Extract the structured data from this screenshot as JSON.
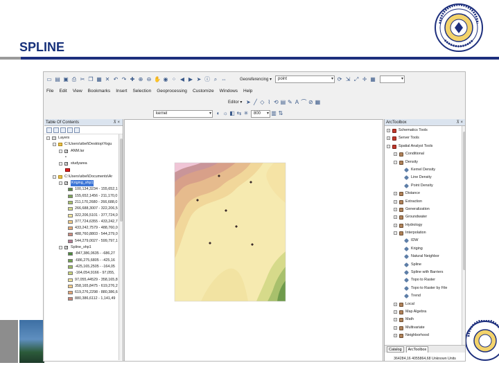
{
  "slide": {
    "title": "SPLINE"
  },
  "toolbar": {
    "georeferencing_label": "Georeferencing ▾",
    "layer_combo": "point",
    "editor_label": "Editor ▾",
    "density_combo": "kernel",
    "cell_size": "800"
  },
  "menu": [
    "File",
    "Edit",
    "View",
    "Bookmarks",
    "Insert",
    "Selection",
    "Geoprocessing",
    "Customize",
    "Windows",
    "Help"
  ],
  "toc": {
    "title": "Table Of Contents",
    "pin": "⊼ ×",
    "items": [
      {
        "text": "Layers",
        "indent": 0,
        "kind": "group"
      },
      {
        "text": "C:\\Users\\sibel\\Desktop\\Yogu",
        "indent": 1,
        "kind": "folder"
      },
      {
        "text": "ANM.lar",
        "indent": 2,
        "kind": "check"
      },
      {
        "text": "•",
        "indent": 3,
        "kind": "plain"
      },
      {
        "text": "studyarea",
        "indent": 2,
        "kind": "check"
      },
      {
        "text": "",
        "indent": 3,
        "kind": "redbox"
      },
      {
        "text": "C:\\Users\\sibel\\Documents\\Ar",
        "indent": 1,
        "kind": "folder"
      },
      {
        "text": "Kriging_shp1",
        "indent": 2,
        "kind": "selected"
      }
    ],
    "kriging_classes": [
      {
        "label": "100,134,3234 - 155,652,1",
        "color": "#5a8a44"
      },
      {
        "label": "155,652,1456 - 211,170,0",
        "color": "#7da457"
      },
      {
        "label": "211,170,2680 - 266,688,0",
        "color": "#a8c06c"
      },
      {
        "label": "266,688,3007 - 322,206,5",
        "color": "#d4d88a"
      },
      {
        "label": "322,206,5101 - 377,724,0",
        "color": "#f2e69d"
      },
      {
        "label": "377,724,6355 - 433,242,7",
        "color": "#f1cc87"
      },
      {
        "label": "433,242,7579 - 488,760,0",
        "color": "#e3a876"
      },
      {
        "label": "488,760,8803 - 544,279,0",
        "color": "#c98a7d"
      },
      {
        "label": "544,279,0027 - 599,797,1",
        "color": "#b37a92"
      }
    ],
    "spline_layer": "Spline_shp1",
    "spline_classes": [
      {
        "label": "-847,386,0635 - -686,27",
        "color": "#4d8a3e"
      },
      {
        "label": "-686,275,6805 - -425,16",
        "color": "#71a050"
      },
      {
        "label": "-425,165,2505 - -164,05",
        "color": "#9cbb63"
      },
      {
        "label": "-164,054,9166 - 97,055,",
        "color": "#c8d27b"
      },
      {
        "label": "97,055,44529 - 358,165,8",
        "color": "#eee199"
      },
      {
        "label": "358,165,8475 - 619,276,2",
        "color": "#f3cb88"
      },
      {
        "label": "619,276,2298 - 880,386,6",
        "color": "#e3a676"
      },
      {
        "label": "880,386,6112 - 1,141,49",
        "color": "#c98778"
      }
    ]
  },
  "toolbox": {
    "title": "ArcToolbox",
    "pin": "⊼ ×",
    "items": [
      {
        "text": "Schematics Tools",
        "indent": 0,
        "icon": "tools"
      },
      {
        "text": "Server Tools",
        "indent": 0,
        "icon": "tools"
      },
      {
        "text": "Spatial Analyst Tools",
        "indent": 0,
        "icon": "tools"
      },
      {
        "text": "Conditional",
        "indent": 1,
        "icon": "hammer"
      },
      {
        "text": "Density",
        "indent": 1,
        "icon": "hammer"
      },
      {
        "text": "Kernel Density",
        "indent": 2,
        "icon": "tool"
      },
      {
        "text": "Line Density",
        "indent": 2,
        "icon": "tool"
      },
      {
        "text": "Point Density",
        "indent": 2,
        "icon": "tool"
      },
      {
        "text": "Distance",
        "indent": 1,
        "icon": "hammer"
      },
      {
        "text": "Extraction",
        "indent": 1,
        "icon": "hammer"
      },
      {
        "text": "Generalization",
        "indent": 1,
        "icon": "hammer"
      },
      {
        "text": "Groundwater",
        "indent": 1,
        "icon": "hammer"
      },
      {
        "text": "Hydrology",
        "indent": 1,
        "icon": "hammer"
      },
      {
        "text": "Interpolation",
        "indent": 1,
        "icon": "hammer"
      },
      {
        "text": "IDW",
        "indent": 2,
        "icon": "tool"
      },
      {
        "text": "Kriging",
        "indent": 2,
        "icon": "tool"
      },
      {
        "text": "Natural Neighbor",
        "indent": 2,
        "icon": "tool"
      },
      {
        "text": "Spline",
        "indent": 2,
        "icon": "tool"
      },
      {
        "text": "Spline with Barriers",
        "indent": 2,
        "icon": "tool"
      },
      {
        "text": "Topo to Raster",
        "indent": 2,
        "icon": "tool"
      },
      {
        "text": "Topo to Raster by File",
        "indent": 2,
        "icon": "tool"
      },
      {
        "text": "Trend",
        "indent": 2,
        "icon": "tool"
      },
      {
        "text": "Local",
        "indent": 1,
        "icon": "hammer"
      },
      {
        "text": "Map Algebra",
        "indent": 1,
        "icon": "hammer"
      },
      {
        "text": "Math",
        "indent": 1,
        "icon": "hammer"
      },
      {
        "text": "Multivariate",
        "indent": 1,
        "icon": "hammer"
      },
      {
        "text": "Neighborhood",
        "indent": 1,
        "icon": "hammer"
      }
    ],
    "tab_catalog": "Catalog",
    "tab_toolbox": "ArcToolbox"
  },
  "status_bar": {
    "coordinates": "364284,16 4055864,68 Unknown Units"
  },
  "colors": {
    "title": "#16307a",
    "accent_bar": "#1d2f7d",
    "selection": "#3b74d6"
  }
}
